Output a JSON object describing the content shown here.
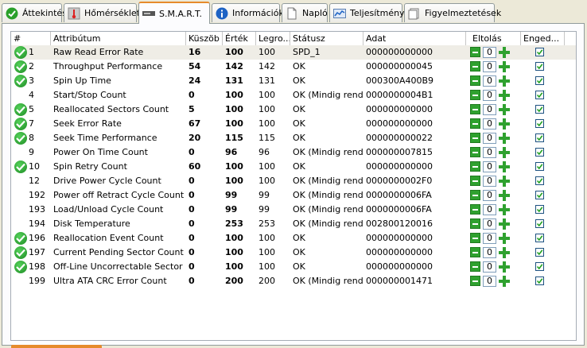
{
  "tabs": [
    {
      "label": "Áttekintés",
      "icon": "check-circle-icon"
    },
    {
      "label": "Hőmérséklet",
      "icon": "thermometer-icon"
    },
    {
      "label": "S.M.A.R.T.",
      "icon": "drive-icon"
    },
    {
      "label": "Információk",
      "icon": "info-icon"
    },
    {
      "label": "Napló",
      "icon": "document-icon"
    },
    {
      "label": "Teljesítmény",
      "icon": "chart-icon"
    },
    {
      "label": "Figyelmeztetések",
      "icon": "alerts-icon"
    }
  ],
  "active_tab": "S.M.A.R.T.",
  "columns": [
    "#",
    "Attribútum",
    "Küszöb",
    "Érték",
    "Legro...",
    "Státusz",
    "Adat",
    "Eltolás",
    "Enged..."
  ],
  "rows": [
    {
      "ok": true,
      "id": "1",
      "attr": "Raw Read Error Rate",
      "thr": "16",
      "val": "100",
      "worst": "100",
      "status": "SPD_1",
      "data": "000000000000",
      "offset": "0",
      "enabled": true
    },
    {
      "ok": true,
      "id": "2",
      "attr": "Throughput Performance",
      "thr": "54",
      "val": "142",
      "worst": "142",
      "status": "OK",
      "data": "000000000045",
      "offset": "0",
      "enabled": true
    },
    {
      "ok": true,
      "id": "3",
      "attr": "Spin Up Time",
      "thr": "24",
      "val": "131",
      "worst": "131",
      "status": "OK",
      "data": "000300A400B9",
      "offset": "0",
      "enabled": true
    },
    {
      "ok": false,
      "id": "4",
      "attr": "Start/Stop Count",
      "thr": "0",
      "val": "100",
      "worst": "100",
      "status": "OK (Mindig rendb...",
      "data": "0000000004B1",
      "offset": "0",
      "enabled": true
    },
    {
      "ok": true,
      "id": "5",
      "attr": "Reallocated Sectors Count",
      "thr": "5",
      "val": "100",
      "worst": "100",
      "status": "OK",
      "data": "000000000000",
      "offset": "0",
      "enabled": true
    },
    {
      "ok": true,
      "id": "7",
      "attr": "Seek Error Rate",
      "thr": "67",
      "val": "100",
      "worst": "100",
      "status": "OK",
      "data": "000000000000",
      "offset": "0",
      "enabled": true
    },
    {
      "ok": true,
      "id": "8",
      "attr": "Seek Time Performance",
      "thr": "20",
      "val": "115",
      "worst": "115",
      "status": "OK",
      "data": "000000000022",
      "offset": "0",
      "enabled": true
    },
    {
      "ok": false,
      "id": "9",
      "attr": "Power On Time Count",
      "thr": "0",
      "val": "96",
      "worst": "96",
      "status": "OK (Mindig rendb...",
      "data": "000000007815",
      "offset": "0",
      "enabled": true
    },
    {
      "ok": true,
      "id": "10",
      "attr": "Spin Retry Count",
      "thr": "60",
      "val": "100",
      "worst": "100",
      "status": "OK",
      "data": "000000000000",
      "offset": "0",
      "enabled": true
    },
    {
      "ok": false,
      "id": "12",
      "attr": "Drive Power Cycle Count",
      "thr": "0",
      "val": "100",
      "worst": "100",
      "status": "OK (Mindig rendb...",
      "data": "0000000002F0",
      "offset": "0",
      "enabled": true
    },
    {
      "ok": false,
      "id": "192",
      "attr": "Power off Retract Cycle Count",
      "thr": "0",
      "val": "99",
      "worst": "99",
      "status": "OK (Mindig rendb...",
      "data": "0000000006FA",
      "offset": "0",
      "enabled": true
    },
    {
      "ok": false,
      "id": "193",
      "attr": "Load/Unload Cycle Count",
      "thr": "0",
      "val": "99",
      "worst": "99",
      "status": "OK (Mindig rendb...",
      "data": "0000000006FA",
      "offset": "0",
      "enabled": true
    },
    {
      "ok": false,
      "id": "194",
      "attr": "Disk Temperature",
      "thr": "0",
      "val": "253",
      "worst": "253",
      "status": "OK (Mindig rendb...",
      "data": "002800120016",
      "offset": "0",
      "enabled": true
    },
    {
      "ok": true,
      "id": "196",
      "attr": "Reallocation Event Count",
      "thr": "0",
      "val": "100",
      "worst": "100",
      "status": "OK",
      "data": "000000000000",
      "offset": "0",
      "enabled": true
    },
    {
      "ok": true,
      "id": "197",
      "attr": "Current Pending Sector Count",
      "thr": "0",
      "val": "100",
      "worst": "100",
      "status": "OK",
      "data": "000000000000",
      "offset": "0",
      "enabled": true
    },
    {
      "ok": true,
      "id": "198",
      "attr": "Off-Line Uncorrectable Sector Co...",
      "thr": "0",
      "val": "100",
      "worst": "100",
      "status": "OK",
      "data": "000000000000",
      "offset": "0",
      "enabled": true
    },
    {
      "ok": false,
      "id": "199",
      "attr": "Ultra ATA CRC Error Count",
      "thr": "0",
      "val": "200",
      "worst": "200",
      "status": "OK (Mindig rendb...",
      "data": "000000001471",
      "offset": "0",
      "enabled": true
    }
  ],
  "colors": {
    "accent": "#e68b2c",
    "ok_green": "#2fa12f",
    "row_selected": "#efede6"
  }
}
